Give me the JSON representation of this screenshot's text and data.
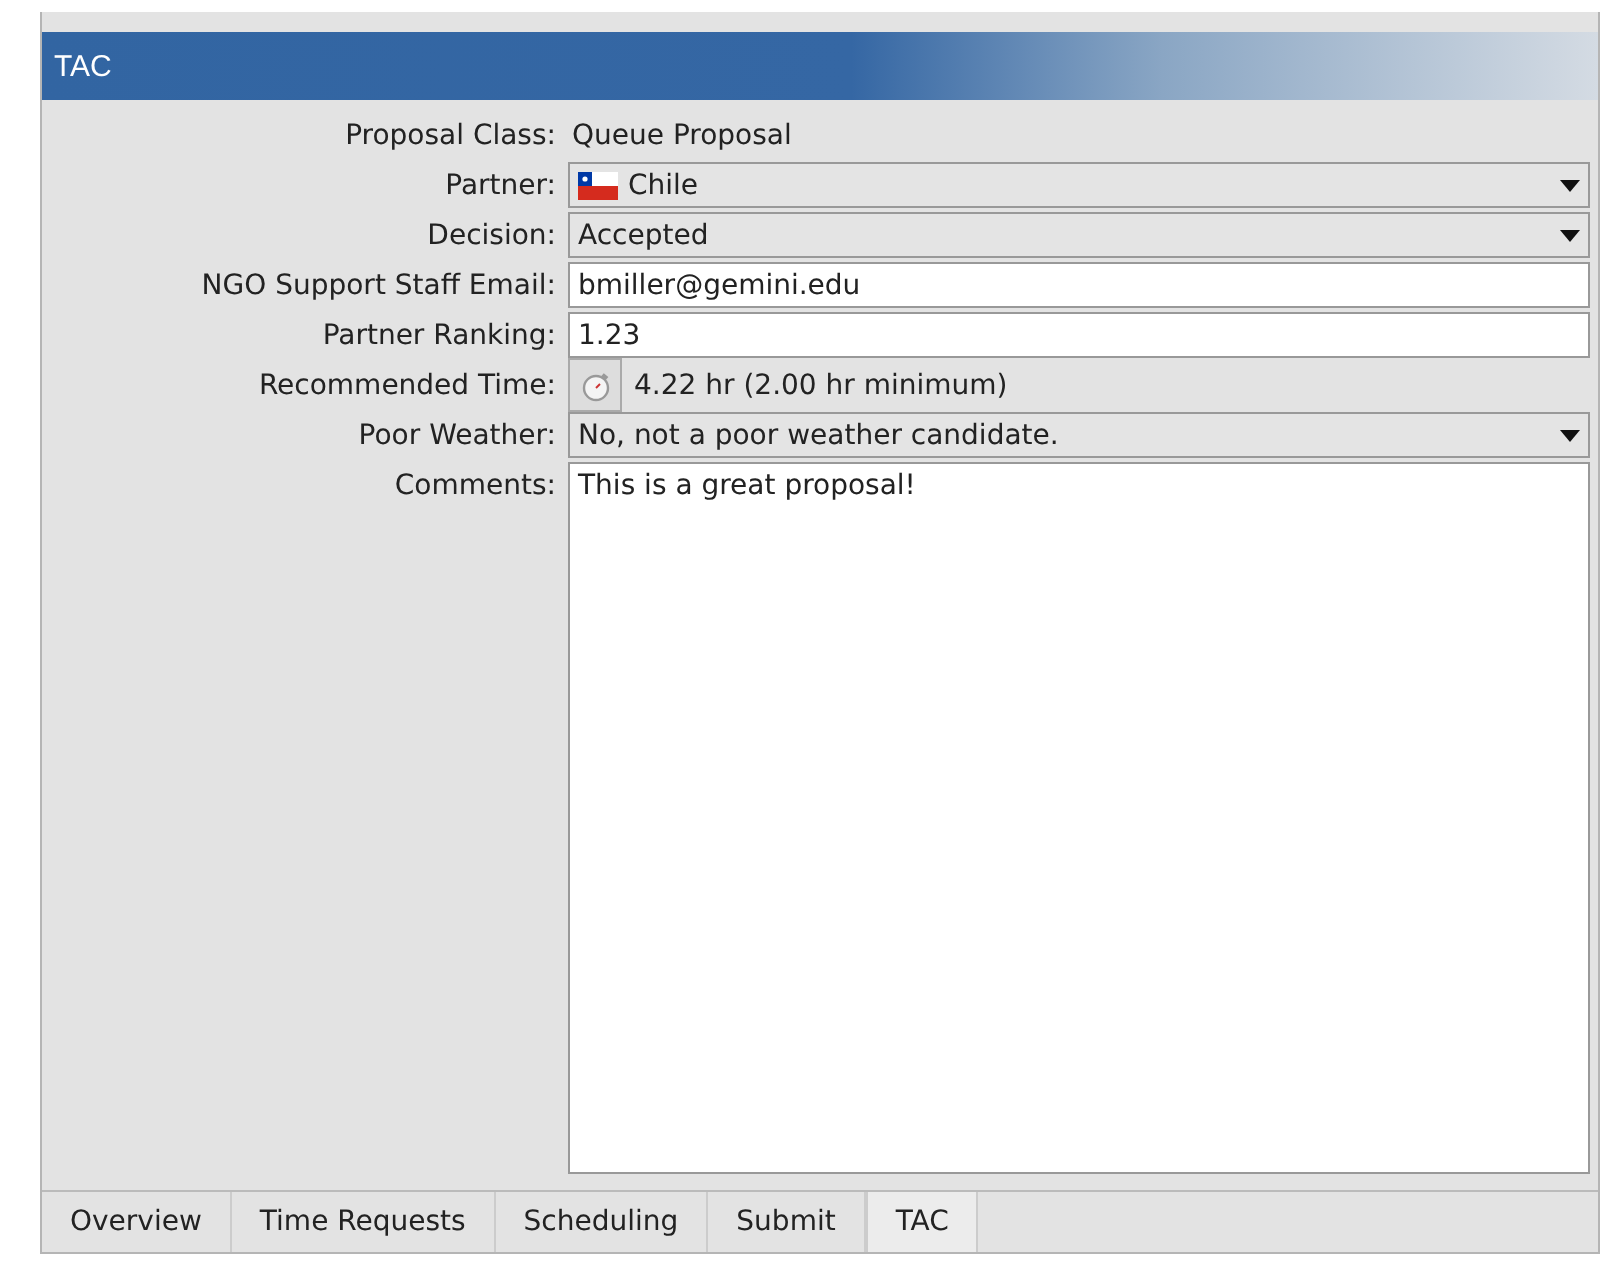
{
  "panel": {
    "title": "TAC"
  },
  "fields": [
    {
      "label": "Proposal Class:",
      "kind": "text",
      "value": "Queue Proposal"
    },
    {
      "label": "Partner:",
      "kind": "dropdown",
      "value": "Chile",
      "flag": true
    },
    {
      "label": "Decision:",
      "kind": "dropdown",
      "value": "Accepted"
    },
    {
      "label": "NGO Support Staff Email:",
      "kind": "input",
      "value": "bmiller@gemini.edu"
    },
    {
      "label": "Partner Ranking:",
      "kind": "input",
      "value": "1.23"
    },
    {
      "label": "Recommended Time:",
      "kind": "time",
      "value": "4.22 hr (2.00 hr minimum)"
    },
    {
      "label": "Poor Weather:",
      "kind": "dropdown",
      "value": "No, not a poor weather candidate."
    },
    {
      "label": "Comments:",
      "kind": "textarea",
      "value": "This is a great proposal!"
    }
  ],
  "tabs": [
    {
      "label": "Overview",
      "selected": false
    },
    {
      "label": "Time Requests",
      "selected": false
    },
    {
      "label": "Scheduling",
      "selected": false
    },
    {
      "label": "Submit",
      "selected": false
    },
    {
      "label": "TAC",
      "selected": true
    }
  ]
}
